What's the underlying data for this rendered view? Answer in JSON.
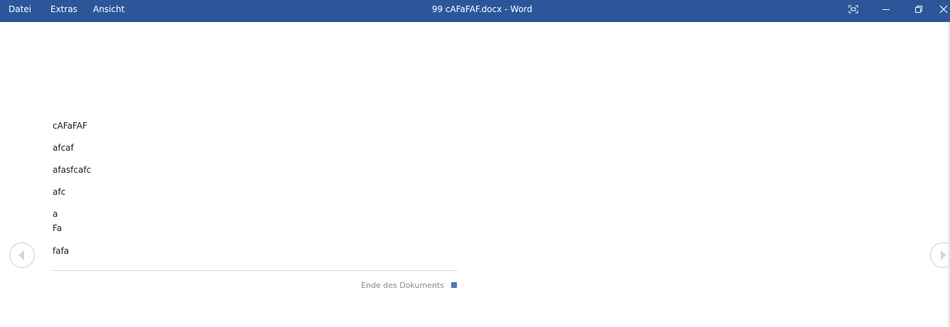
{
  "titlebar": {
    "menu": [
      "Datei",
      "Extras",
      "Ansicht"
    ],
    "title": "99 cAFaFAF.docx  -  Word",
    "bg_color": "#2b579a"
  },
  "document": {
    "lines": [
      "cAFaFAF",
      "afcaf",
      "afasfcafc",
      "afc",
      "a",
      "Fa",
      "fafa"
    ],
    "end_label": "Ende des Dokuments",
    "end_marker_color": "#4a78b5"
  },
  "icons": {
    "focus": "focus-mode-icon",
    "minimize": "minimize-icon",
    "restore": "restore-icon",
    "close": "close-icon",
    "prev": "previous-page-icon",
    "next": "next-page-icon"
  }
}
